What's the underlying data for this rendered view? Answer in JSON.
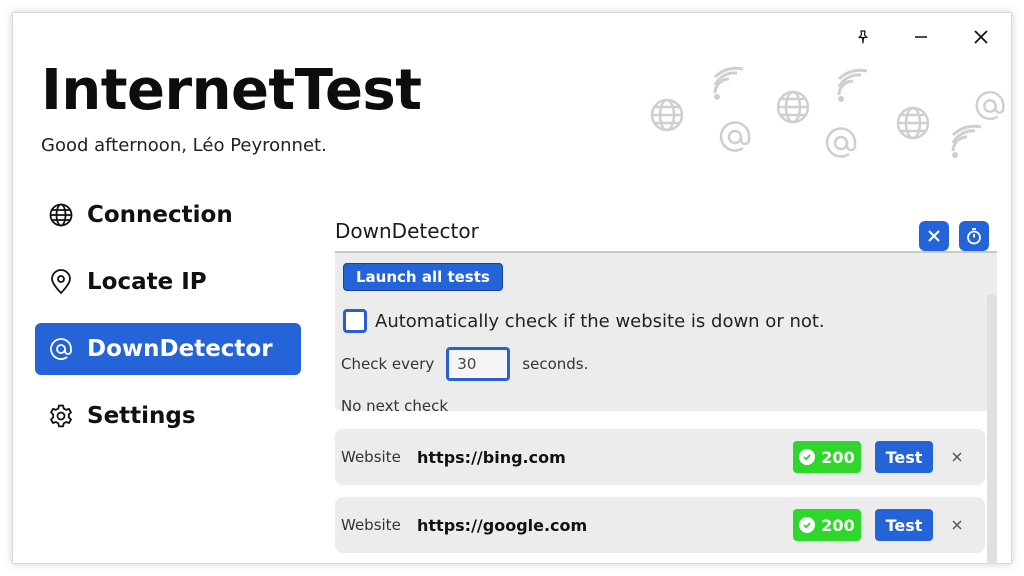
{
  "app": {
    "title": "InternetTest",
    "greeting": "Good afternoon, Léo Peyronnet."
  },
  "titlebar": {
    "pin_icon": "pin-icon",
    "minimize_icon": "minimize-icon",
    "close_icon": "close-icon"
  },
  "sidebar": {
    "items": [
      {
        "label": "Connection",
        "icon": "globe-icon",
        "active": false
      },
      {
        "label": "Locate IP",
        "icon": "location-pin-icon",
        "active": false
      },
      {
        "label": "DownDetector",
        "icon": "at-sign-icon",
        "active": true
      },
      {
        "label": "Settings",
        "icon": "gear-icon",
        "active": false
      }
    ]
  },
  "main": {
    "section_title": "DownDetector",
    "header_buttons": [
      {
        "icon": "close-icon"
      },
      {
        "icon": "timer-icon"
      }
    ],
    "panel": {
      "launch_label": "Launch all tests",
      "auto_check_label": "Automatically check if the website is down or not.",
      "auto_check_checked": false,
      "check_every_prefix": "Check every",
      "interval_value": "30",
      "check_every_suffix": "seconds.",
      "next_check": "No next check"
    },
    "sites": [
      {
        "key": "Website",
        "url": "https://bing.com",
        "status": "200",
        "test_label": "Test"
      },
      {
        "key": "Website",
        "url": "https://google.com",
        "status": "200",
        "test_label": "Test"
      }
    ]
  },
  "colors": {
    "accent": "#2563d9",
    "status_ok": "#2fd62c",
    "panel_bg": "#ececec"
  }
}
